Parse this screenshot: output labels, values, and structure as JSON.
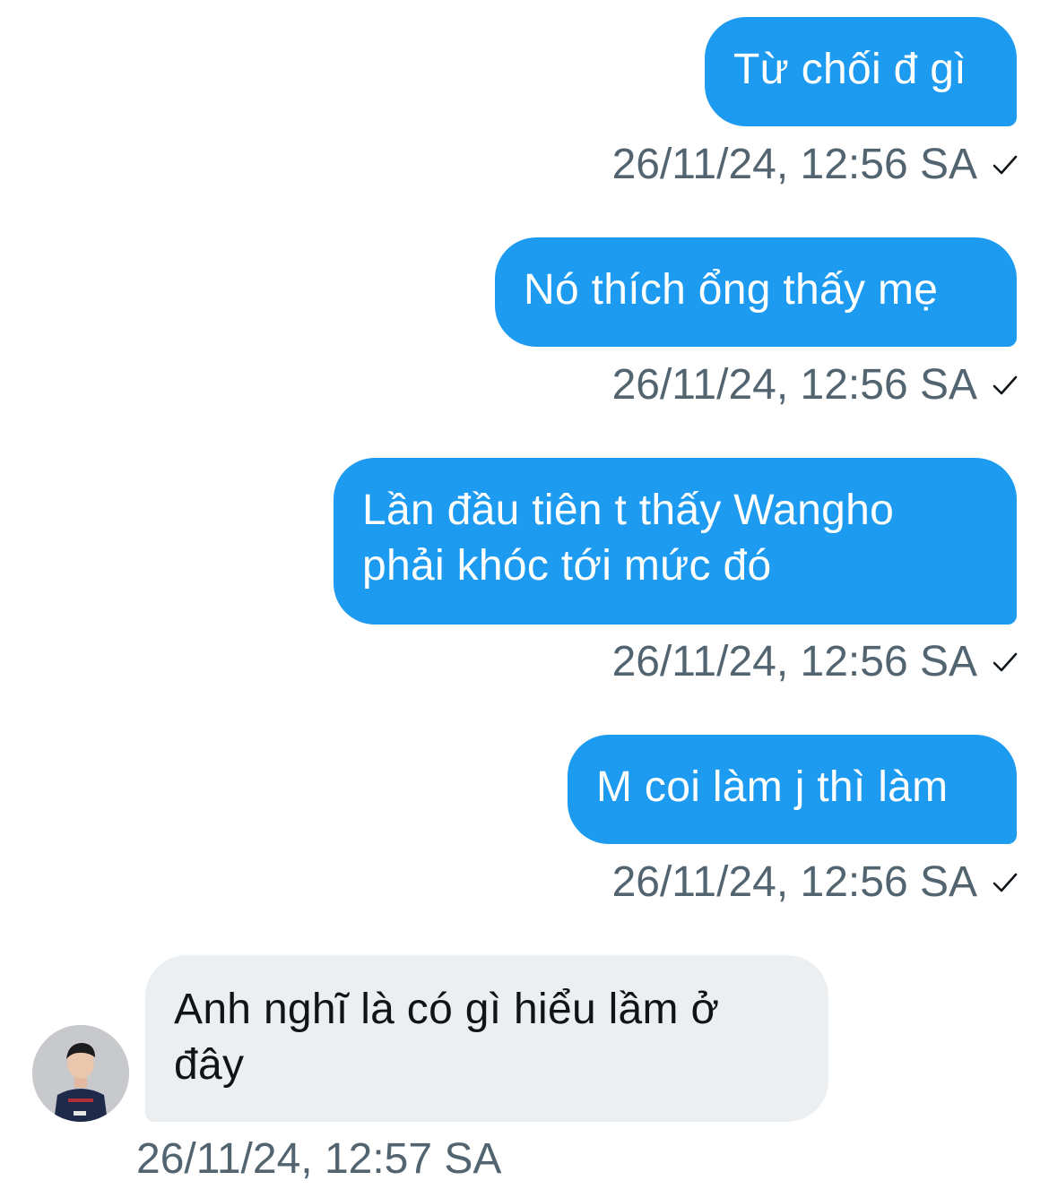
{
  "conversation": {
    "messages": [
      {
        "direction": "outgoing",
        "text": "Từ chối đ gì",
        "timestamp": "26/11/24, 12:56 SA",
        "status_icon": "check-icon"
      },
      {
        "direction": "outgoing",
        "text": "Nó thích ổng thấy mẹ",
        "timestamp": "26/11/24, 12:56 SA",
        "status_icon": "check-icon"
      },
      {
        "direction": "outgoing",
        "text": "Lần đầu tiên t thấy Wangho\nphải khóc tới mức đó",
        "timestamp": "26/11/24, 12:56 SA",
        "status_icon": "check-icon"
      },
      {
        "direction": "outgoing",
        "text": "M coi làm j thì làm",
        "timestamp": "26/11/24, 12:56 SA",
        "status_icon": "check-icon"
      },
      {
        "direction": "incoming",
        "text": "Anh nghĩ là có gì hiểu lầm ở\nđây",
        "timestamp": "26/11/24, 12:57 SA",
        "avatar_icon": "user-avatar"
      }
    ]
  },
  "colors": {
    "outgoing_bubble": "#1d9bf0",
    "incoming_bubble": "#eceff2",
    "timestamp_text": "#536471",
    "incoming_text": "#0f1419"
  }
}
